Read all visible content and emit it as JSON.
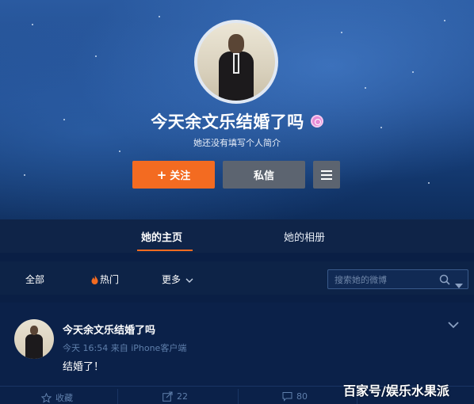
{
  "profile": {
    "name": "今天余文乐结婚了吗",
    "bio": "她还没有填写个人简介",
    "follow_label": "关注",
    "message_label": "私信"
  },
  "tabs": [
    {
      "label": "她的主页",
      "active": true
    },
    {
      "label": "她的相册",
      "active": false
    }
  ],
  "filters": {
    "all": "全部",
    "hot": "热门",
    "more": "更多",
    "search_placeholder": "搜索她的微博"
  },
  "post": {
    "author": "今天余文乐结婚了吗",
    "meta": "今天 16:54 来自 iPhone客户端",
    "text": "结婚了！",
    "actions": {
      "favorite": "收藏",
      "forward_count": "22",
      "comment_count": "80"
    }
  },
  "watermark": "百家号/娱乐水果派",
  "colors": {
    "accent": "#f36b21",
    "background": "#0a1f45",
    "button_gray": "#5c6470",
    "muted_text": "#5f7fab"
  },
  "icons": [
    "badge-icon",
    "plus-icon",
    "menu-icon",
    "fire-icon",
    "chevron-down-icon",
    "search-icon",
    "caret-down-icon",
    "star-icon",
    "forward-icon",
    "comment-icon"
  ]
}
